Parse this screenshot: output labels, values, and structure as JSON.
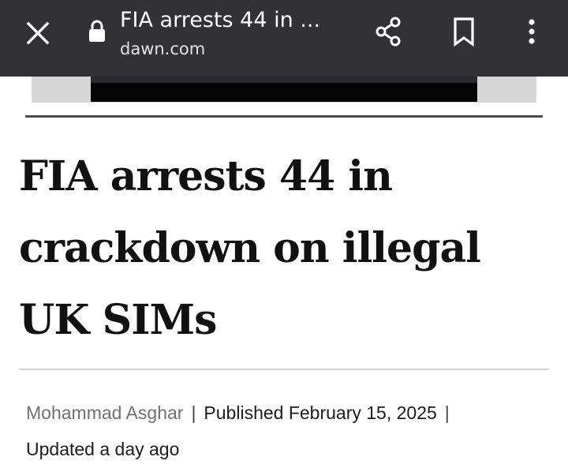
{
  "toolbar": {
    "tab_title": "FIA arrests 44 in ...",
    "domain": "dawn.com",
    "icons": {
      "close": "close-icon",
      "lock": "lock-icon",
      "share": "share-icon",
      "bookmark": "bookmark-icon",
      "menu": "more-vert-icon"
    }
  },
  "article": {
    "headline": "FIA arrests 44 in crackdown on illegal UK SIMs",
    "author": "Mohammad Asghar",
    "separator": "|",
    "published": "Published February 15, 2025",
    "updated": "Updated a day ago"
  },
  "colors": {
    "toolbar_bg": "#323234",
    "headline": "#111111",
    "author": "#707070"
  }
}
